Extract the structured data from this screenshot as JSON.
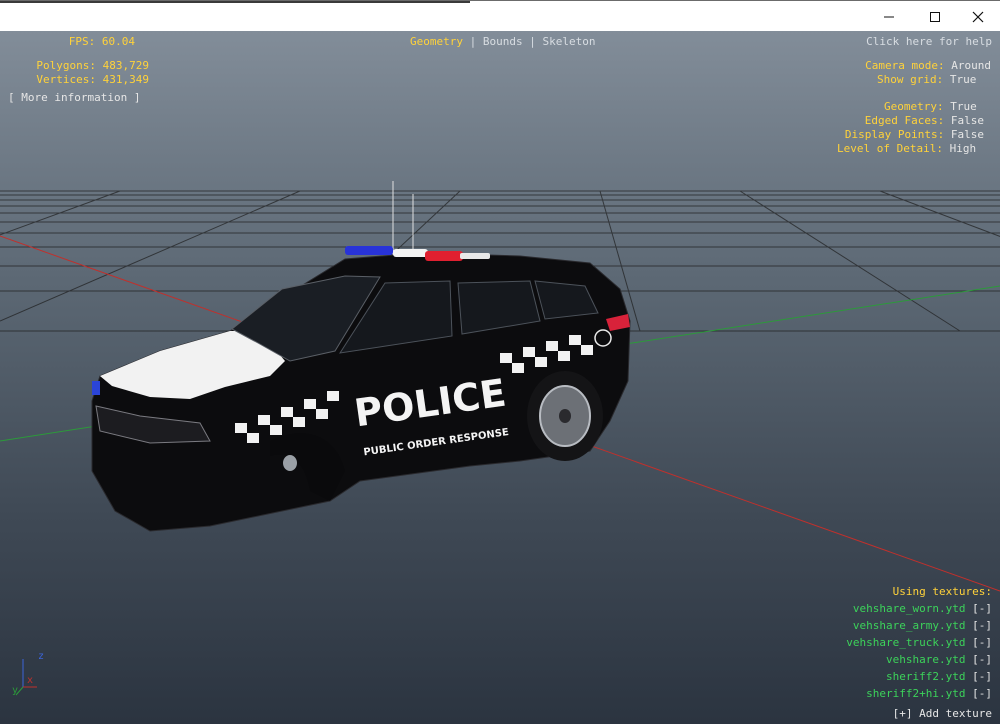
{
  "window": {
    "minimize_icon": "minimize-icon",
    "maximize_icon": "maximize-icon",
    "close_icon": "close-icon"
  },
  "hud": {
    "fps_label": "FPS:",
    "fps_value": "60.04",
    "polygons_label": "Polygons:",
    "polygons_value": "483,729",
    "vertices_label": "Vertices:",
    "vertices_value": "431,349",
    "more_info": "[ More information ]"
  },
  "tabs": {
    "geometry": "Geometry",
    "bounds": "Bounds",
    "skeleton": "Skeleton",
    "separator": "|"
  },
  "help": "Click here for help",
  "settings": {
    "camera_mode_label": "Camera mode:",
    "camera_mode_value": "Around",
    "show_grid_label": "Show grid:",
    "show_grid_value": "True",
    "geometry_label": "Geometry:",
    "geometry_value": "True",
    "edged_faces_label": "Edged Faces:",
    "edged_faces_value": "False",
    "display_points_label": "Display Points:",
    "display_points_value": "False",
    "lod_label": "Level of Detail:",
    "lod_value": "High"
  },
  "textures": {
    "heading": "Using textures:",
    "remove_label": "[-]",
    "items": [
      "vehshare_worn.ytd",
      "vehshare_army.ytd",
      "vehshare_truck.ytd",
      "vehshare.ytd",
      "sheriff2.ytd",
      "sheriff2+hi.ytd"
    ],
    "add_label": "[+] Add texture"
  },
  "model": {
    "livery_main": "POLICE",
    "livery_sub": "PUBLIC ORDER RESPONSE"
  },
  "axes": {
    "x": "x",
    "y": "y",
    "z": "z"
  },
  "colors": {
    "hud_yellow": "#ffd23a",
    "hud_white": "#e6e6e6",
    "texture_green": "#3cd25a",
    "grid_line": "#1e1e1e"
  }
}
